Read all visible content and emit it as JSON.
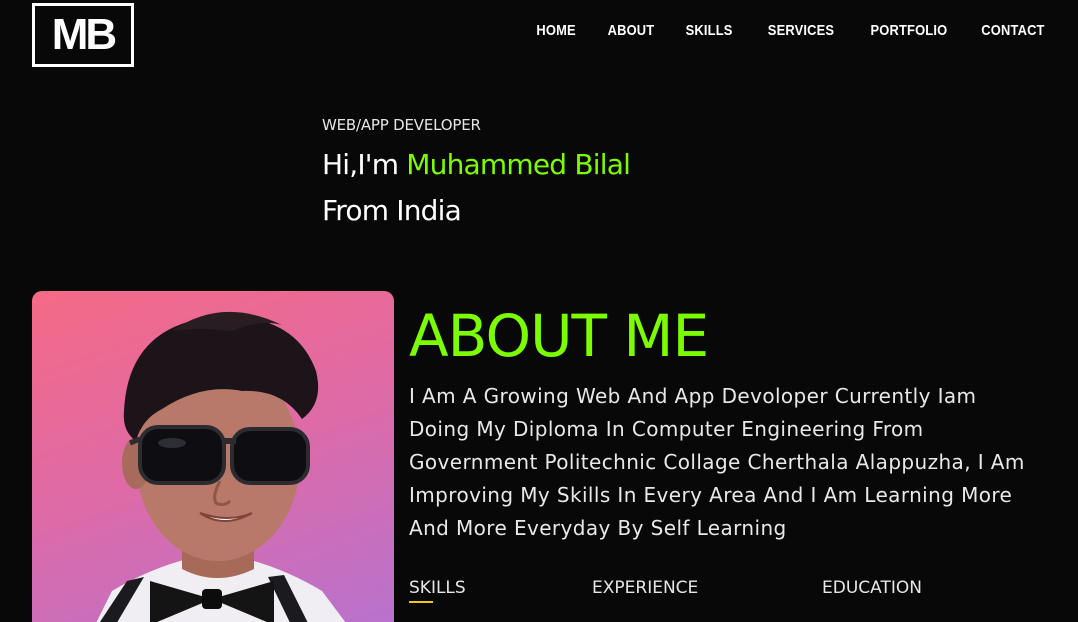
{
  "header": {
    "logo_text": "MB",
    "nav": [
      "HOME",
      "ABOUT",
      "SKILLS",
      "SERVICES",
      "PORTFOLIO",
      "CONTACT"
    ]
  },
  "hero": {
    "subtitle": "WEB/APP DEVELOPER",
    "greeting": "Hi,I'm",
    "name": "Muhammed Bilal",
    "location": "From India"
  },
  "about": {
    "title": "ABOUT ME",
    "text": "I Am A Growing Web And App Devoloper Currently Iam Doing My Diploma In Computer Engineering From Government Politechnic Collage Cherthala Alappuzha, I Am Improving My Skills In Every Area And I Am Learning More And More Everyday By Self Learning",
    "tabs": [
      "SKILLS",
      "EXPERIENCE",
      "EDUCATION"
    ],
    "active_tab": "SKILLS"
  },
  "colors": {
    "accent": "#7cfc00",
    "background": "#080808",
    "tab_underline": "#f5c518"
  }
}
